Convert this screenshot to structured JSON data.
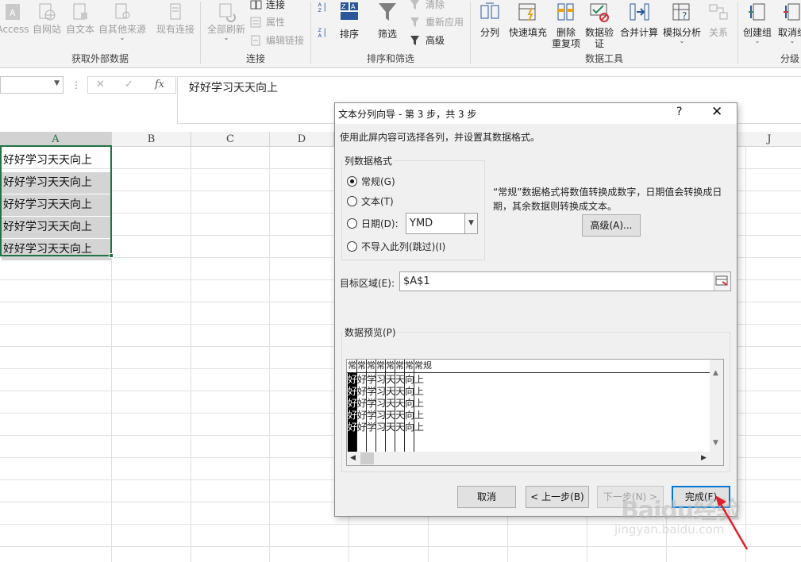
{
  "ribbon": {
    "get_external": {
      "label": "获取外部数据",
      "buttons": [
        "Access",
        "自网站",
        "自文本",
        "自其他来源",
        "现有连接"
      ]
    },
    "connections": {
      "label": "连接",
      "refresh_all": "全部刷新",
      "connections": "连接",
      "properties": "属性",
      "edit_links": "编辑链接"
    },
    "sort_filter": {
      "label": "排序和筛选",
      "sort": "排序",
      "filter": "筛选",
      "clear": "清除",
      "reapply": "重新应用",
      "advanced": "高级"
    },
    "data_tools": {
      "label": "数据工具",
      "text_to_columns": "分列",
      "flash_fill": "快速填充",
      "remove_dup_1": "删除",
      "remove_dup_2": "重复项",
      "validation_1": "数据验",
      "validation_2": "证",
      "consolidate": "合并计算",
      "what_if": "模拟分析",
      "relationships": "关系"
    },
    "outline": {
      "label": "分级",
      "group": "创建组",
      "ungroup": "取消组"
    }
  },
  "formula_bar": {
    "fx": "fx",
    "content": "好好学习天天向上"
  },
  "grid": {
    "columns": [
      "A",
      "B",
      "C",
      "D",
      "J"
    ],
    "cells": [
      "好好学习天天向上",
      "好好学习天天向上",
      "好好学习天天向上",
      "好好学习天天向上",
      "好好学习天天向上"
    ]
  },
  "dialog": {
    "title": "文本分列向导 - 第 3 步，共 3 步",
    "help": "?",
    "close": "✕",
    "instruction": "使用此屏内容可选择各列，并设置其数据格式。",
    "format_group_label": "列数据格式",
    "radios": [
      {
        "label": "常规(G)",
        "checked": true
      },
      {
        "label": "文本(T)",
        "checked": false
      },
      {
        "label": "日期(D):",
        "checked": false
      },
      {
        "label": "不导入此列(跳过)(I)",
        "checked": false
      }
    ],
    "date_format": "YMD",
    "description": "“常规”数据格式将数值转换成数字，日期值会转换成日期，其余数据则转换成文本。",
    "advanced_button": "高级(A)...",
    "destination_label": "目标区域(E):",
    "destination_value": "$A$1",
    "preview_label": "数据预览(P)",
    "preview_header": [
      "常",
      "常",
      "常",
      "常",
      "常",
      "常",
      "常",
      "常规"
    ],
    "preview_rows": [
      [
        "好",
        "好学习天天向上"
      ],
      [
        "好",
        "好学习天天向上"
      ],
      [
        "好",
        "好学习天天向上"
      ],
      [
        "好",
        "好学习天天向上"
      ],
      [
        "好",
        "好学习天天向上"
      ]
    ],
    "cancel": "取消",
    "back": "< 上一步(B)",
    "next": "下一步(N) >",
    "finish": "完成(F)"
  },
  "watermark": {
    "brand": "Baidu经验",
    "url": "jingyan.baidu.com"
  },
  "colors": {
    "accent": "#217346",
    "dialog_default_border": "#0078d7",
    "arrow": "#e0202a"
  }
}
